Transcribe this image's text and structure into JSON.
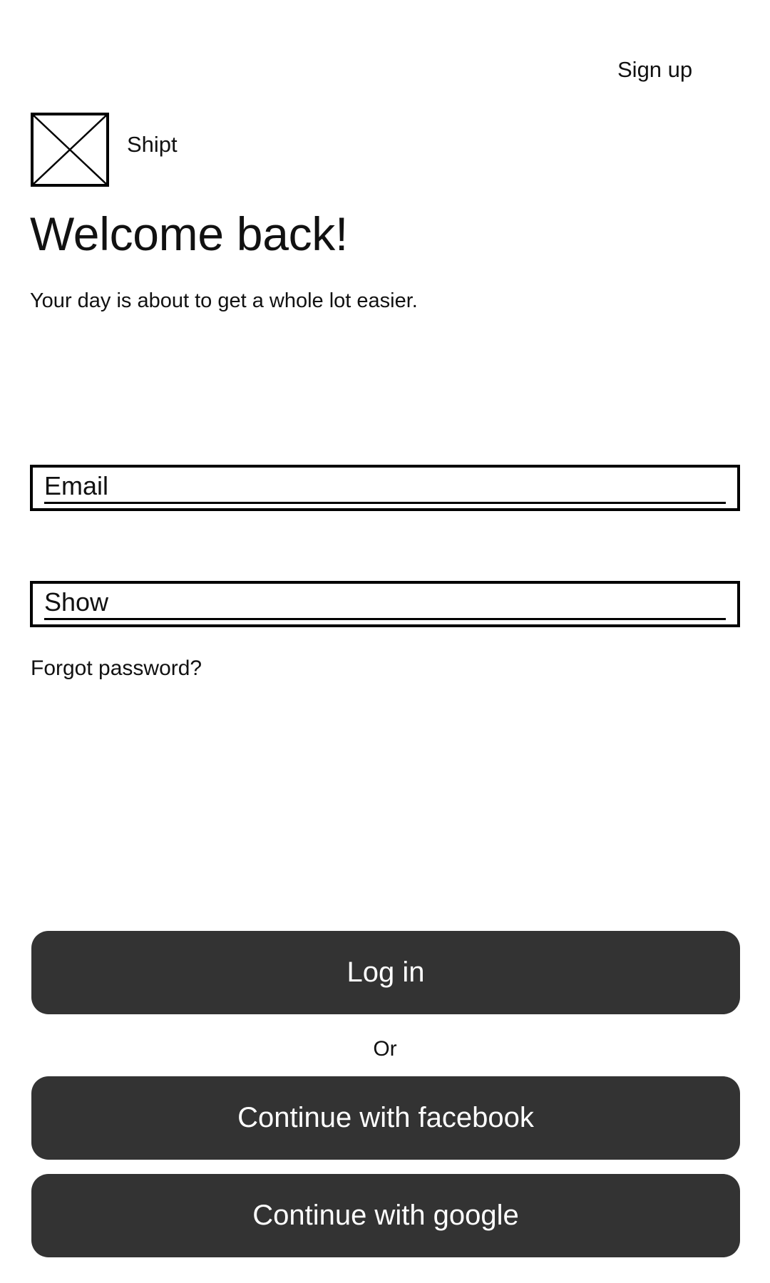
{
  "header": {
    "signup_label": "Sign up"
  },
  "brand": {
    "logo_icon": "image-placeholder-icon",
    "name": "Shipt"
  },
  "intro": {
    "title": "Welcome back!",
    "subtitle": "Your day is about to get a whole lot easier."
  },
  "form": {
    "email": {
      "value": "",
      "placeholder": "Email"
    },
    "password": {
      "value": "",
      "placeholder": "Show"
    },
    "forgot_label": "Forgot password?"
  },
  "actions": {
    "login_label": "Log in",
    "or_label": "Or",
    "facebook_label": "Continue with facebook",
    "google_label": "Continue with google"
  },
  "colors": {
    "button_background": "#333333",
    "button_text": "#ffffff",
    "text": "#111111",
    "border": "#000000"
  }
}
